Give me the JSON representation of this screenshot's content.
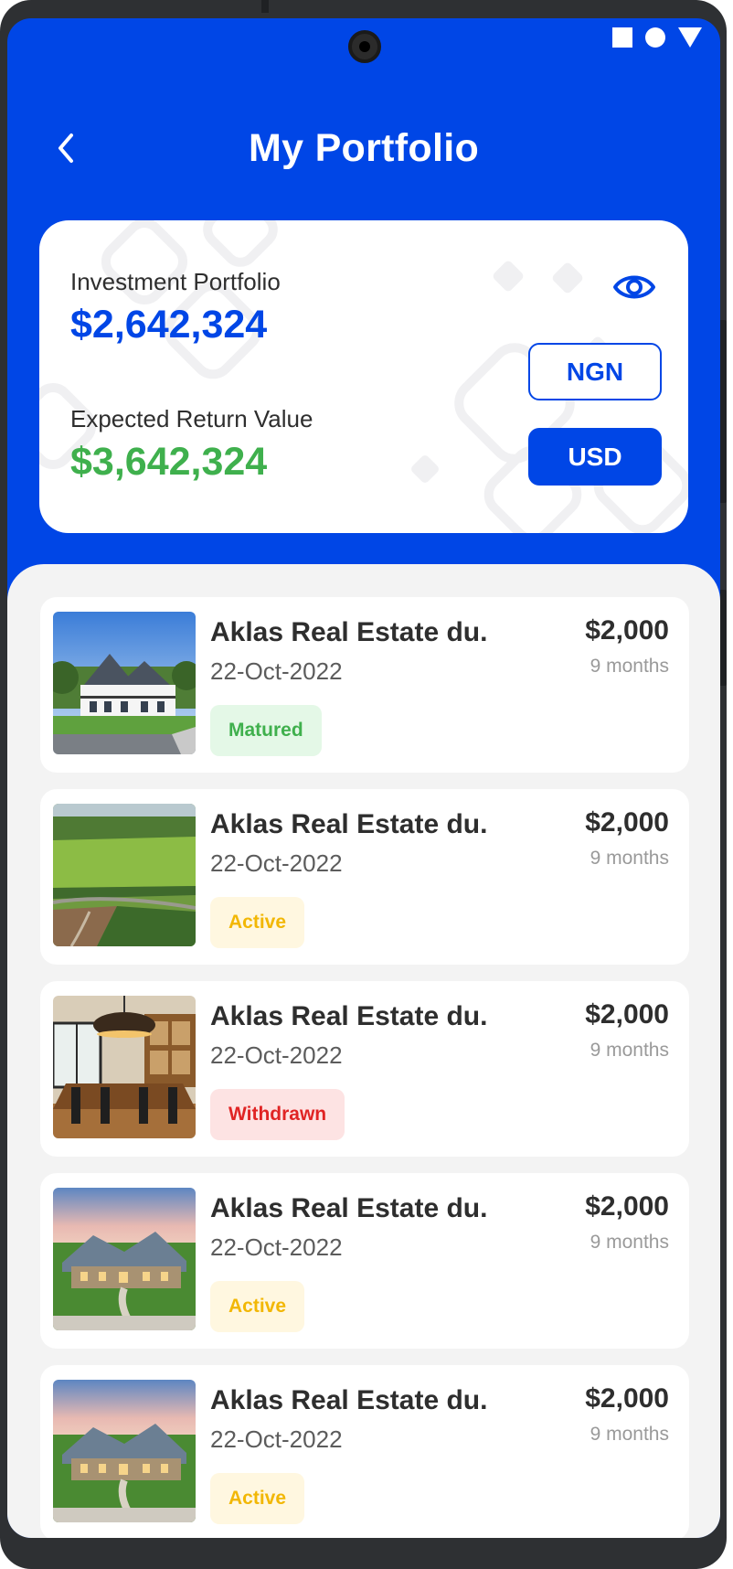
{
  "header": {
    "title": "My Portfolio",
    "back_icon": "chevron-left-icon"
  },
  "status_bar": {
    "icons": [
      "square-icon",
      "circle-icon",
      "triangle-icon"
    ]
  },
  "summary": {
    "investment_label": "Investment Portfolio",
    "investment_value": "$2,642,324",
    "return_label": "Expected Return Value",
    "return_value": "$3,642,324",
    "visibility_icon": "eye-icon",
    "currency_options": [
      "NGN",
      "USD"
    ],
    "selected_currency": "USD"
  },
  "colors": {
    "primary": "#0046e6",
    "return_green": "#3fb04d",
    "matured": "#3fb04d",
    "active": "#f2b705",
    "withdrawn": "#e02424"
  },
  "investments": [
    {
      "title": "Aklas Real Estate du.",
      "date": "22-Oct-2022",
      "price": "$2,000",
      "duration": "9 months",
      "status": "Matured",
      "image": "farmhouse-photo"
    },
    {
      "title": "Aklas Real Estate du.",
      "date": "22-Oct-2022",
      "price": "$2,000",
      "duration": "9 months",
      "status": "Active",
      "image": "farmland-photo"
    },
    {
      "title": "Aklas Real Estate du.",
      "date": "22-Oct-2022",
      "price": "$2,000",
      "duration": "9 months",
      "status": "Withdrawn",
      "image": "dining-room-photo"
    },
    {
      "title": "Aklas Real Estate du.",
      "date": "22-Oct-2022",
      "price": "$2,000",
      "duration": "9 months",
      "status": "Active",
      "image": "stone-house-photo"
    },
    {
      "title": "Aklas Real Estate du.",
      "date": "22-Oct-2022",
      "price": "$2,000",
      "duration": "9 months",
      "status": "Active",
      "image": "stone-house-photo"
    }
  ]
}
